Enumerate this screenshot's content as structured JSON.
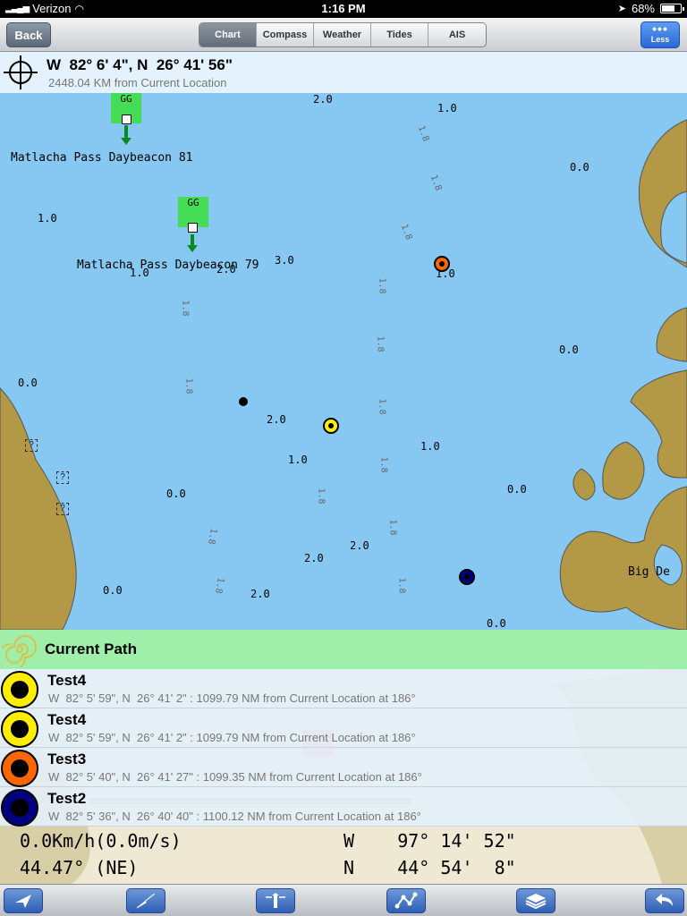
{
  "status": {
    "carrier": "Verizon",
    "time": "1:16 PM",
    "battery": "68%",
    "battery_level": 0.68
  },
  "nav": {
    "back": "Back",
    "tabs": [
      {
        "label": "Chart",
        "active": true
      },
      {
        "label": "Compass",
        "active": false
      },
      {
        "label": "Weather",
        "active": false
      },
      {
        "label": "Tides",
        "active": false
      },
      {
        "label": "AIS",
        "active": false
      }
    ],
    "less": "Less"
  },
  "location": {
    "coord": "W  82° 6' 4\", N  26° 41' 56\"",
    "distance": "2448.04 KM from Current Location"
  },
  "map": {
    "labels": {
      "daybeacon_81": "Matlacha Pass Daybeacon 81",
      "daybeacon_79": "Matlacha Pass Daybeacon 79",
      "big_de": "Big De",
      "gg": "GG"
    },
    "depths": [
      "2.0",
      "1.0",
      "0.0",
      "1.0",
      "3.0",
      "1.0",
      "2.0",
      "1.0",
      "0.0",
      "0.0",
      "2.0",
      "1.0",
      "1.0",
      "0.0",
      "0.0",
      "2.0",
      "2.0",
      "0.0",
      "2.0",
      "0.0",
      "1.0"
    ],
    "contours": [
      "1.8"
    ]
  },
  "panel": {
    "path_title": "Current Path",
    "waypoints": [
      {
        "name": "Test4",
        "detail": "W  82° 5' 59\", N  26° 41' 2\" : 1099.79 NM from Current Location at 186°",
        "color": "#ffee00"
      },
      {
        "name": "Test4",
        "detail": "W  82° 5' 59\", N  26° 41' 2\" : 1099.79 NM from Current Location at 186°",
        "color": "#ffee00"
      },
      {
        "name": "Test3",
        "detail": "W  82° 5' 40\", N  26° 41' 27\" : 1099.35 NM from Current Location at 186°",
        "color": "#ff6600"
      },
      {
        "name": "Test2",
        "detail": "W  82° 5' 36\", N  26° 40' 40\" : 1100.12 NM from Current Location at 186°",
        "color": "#000080"
      }
    ]
  },
  "readout": {
    "speed": "0.0Km/h(0.0m/s)",
    "heading": "44.47° (NE)",
    "lon": "W    97° 14' 52\"",
    "lat": "N    44° 54'  8\""
  },
  "colors": {
    "water": "#86c8f2",
    "land": "#b39845",
    "path_header": "#96f0a5",
    "accent": "#2f5fb5"
  }
}
